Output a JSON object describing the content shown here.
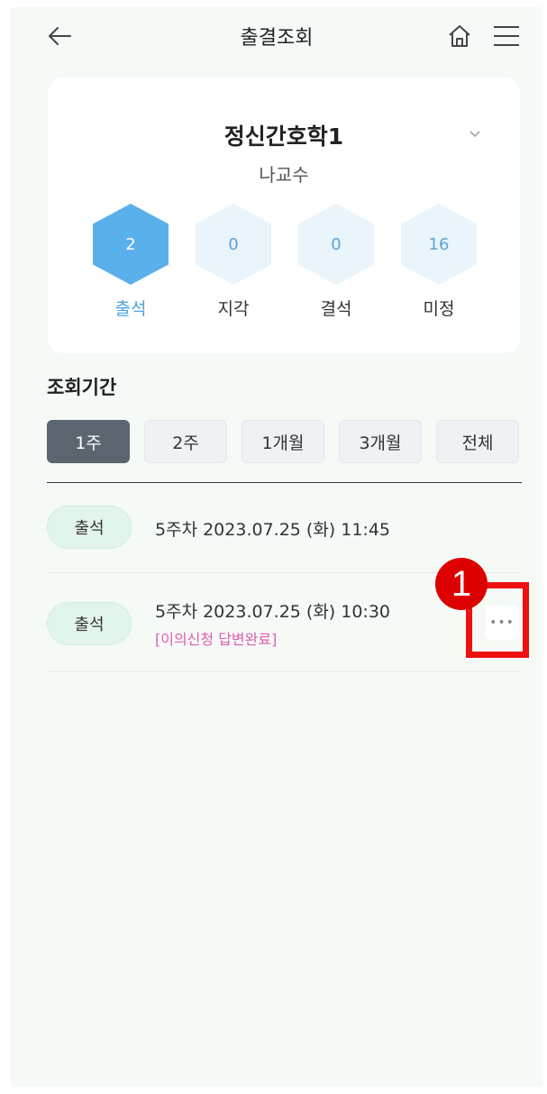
{
  "header": {
    "title": "출결조회",
    "back_icon": "arrow-left-icon",
    "home_icon": "home-icon",
    "menu_icon": "hamburger-menu-icon"
  },
  "course": {
    "name": "정신간호학1",
    "professor": "나교수",
    "dropdown_icon": "chevron-down-icon"
  },
  "stats": [
    {
      "value": "2",
      "label": "출석",
      "active": true
    },
    {
      "value": "0",
      "label": "지각",
      "active": false
    },
    {
      "value": "0",
      "label": "결석",
      "active": false
    },
    {
      "value": "16",
      "label": "미정",
      "active": false
    }
  ],
  "period": {
    "title": "조회기간",
    "tabs": [
      "1주",
      "2주",
      "1개월",
      "3개월",
      "전체"
    ],
    "selected": "1주"
  },
  "records": [
    {
      "status": "출석",
      "text": "5주차 2023.07.25 (화) 11:45",
      "note": ""
    },
    {
      "status": "출석",
      "text": "5주차 2023.07.25 (화) 10:30",
      "note": "[이의신청 답변완료]"
    }
  ],
  "annotation": {
    "step": "1"
  },
  "colors": {
    "accent_blue": "#5ab0ea",
    "badge_green": "#e2f5ea",
    "note_pink": "#e05cb0",
    "highlight_red": "#ee1111"
  }
}
